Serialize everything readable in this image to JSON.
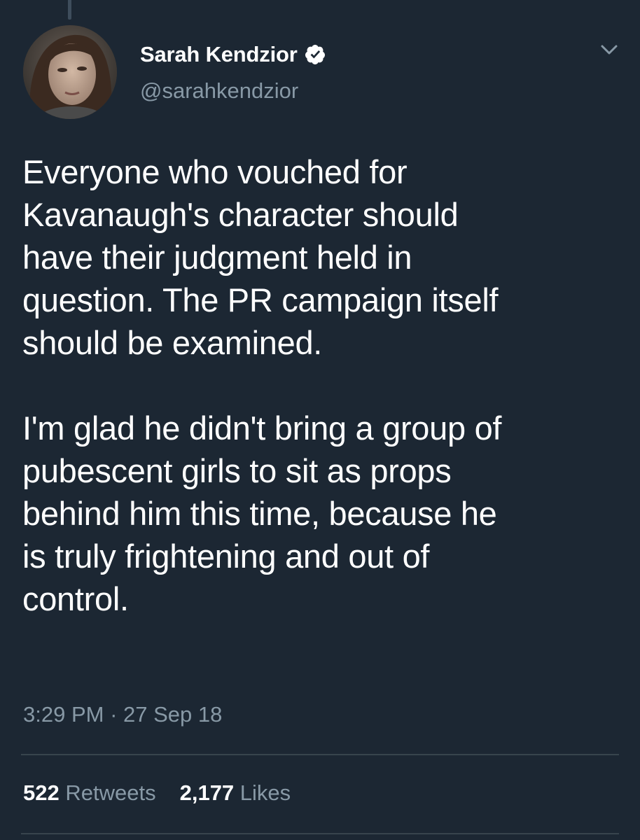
{
  "author": {
    "display_name": "Sarah Kendzior",
    "handle": "@sarahkendzior",
    "verified": true
  },
  "tweet": {
    "paragraphs": [
      "Everyone who vouched for\nKavanaugh's character should\nhave their judgment held in\nquestion. The PR campaign itself\nshould be examined.",
      "I'm glad he didn't bring a group of\npubescent girls to sit as props\nbehind him this time, because he\nis truly frightening and out of\ncontrol."
    ],
    "time": "3:29 PM",
    "separator": "·",
    "date": "27 Sep 18"
  },
  "stats": {
    "retweets_count": "522",
    "retweets_label": "Retweets",
    "likes_count": "2,177",
    "likes_label": "Likes"
  },
  "icons": {
    "verified": "verified-badge-icon",
    "menu": "chevron-down-icon"
  },
  "colors": {
    "background": "#1c2733",
    "primary_text": "#ffffff",
    "secondary_text": "#8899a6",
    "divider": "#38444d"
  }
}
